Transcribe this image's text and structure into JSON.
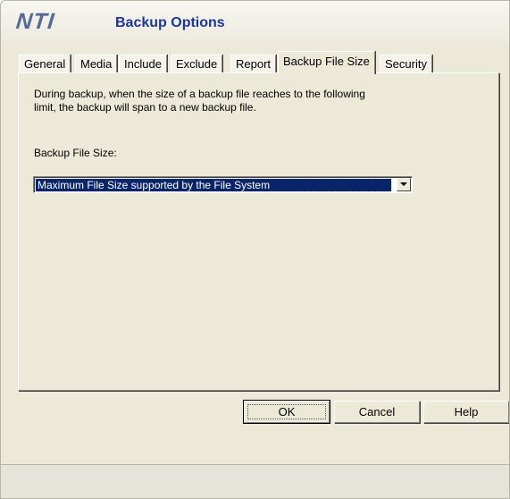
{
  "header": {
    "logo_text": "NTI",
    "title": "Backup Options"
  },
  "tabs": [
    {
      "label": "General",
      "active": false
    },
    {
      "label": "Media",
      "active": false
    },
    {
      "label": "Include",
      "active": false
    },
    {
      "label": "Exclude",
      "active": false
    },
    {
      "label": "Report",
      "active": false
    },
    {
      "label": "Backup File Size",
      "active": true
    },
    {
      "label": "Security",
      "active": false
    }
  ],
  "panel": {
    "description_line1": "During backup, when the size of a backup file reaches to the following",
    "description_line2": "limit, the backup will span to a new backup file.",
    "size_label": "Backup File Size:",
    "size_select": {
      "value": "Maximum File Size supported by the File System"
    }
  },
  "buttons": {
    "ok": "OK",
    "cancel": "Cancel",
    "help": "Help"
  },
  "colors": {
    "title": "#1e3596",
    "logo": "#566b97",
    "dialog_background": "#ece9d8",
    "selection": "#0a246a"
  }
}
